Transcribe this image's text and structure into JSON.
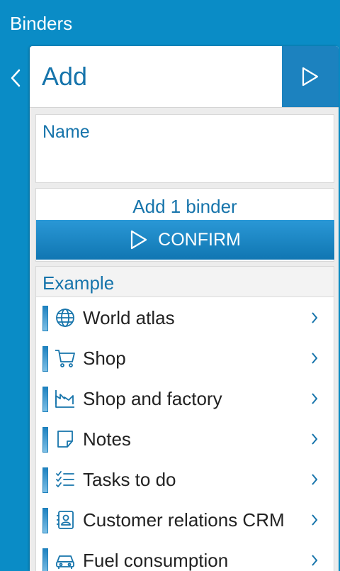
{
  "topbar": {
    "title": "Binders"
  },
  "panel": {
    "title": "Add"
  },
  "form": {
    "name_label": "Name"
  },
  "summary": {
    "count_text": "Add 1 binder",
    "confirm_label": "CONFIRM"
  },
  "list": {
    "header": "Example",
    "items": [
      {
        "label": "World atlas",
        "icon": "globe-icon"
      },
      {
        "label": "Shop",
        "icon": "cart-icon"
      },
      {
        "label": "Shop and factory",
        "icon": "factory-icon"
      },
      {
        "label": "Notes",
        "icon": "note-icon"
      },
      {
        "label": "Tasks to do",
        "icon": "checklist-icon"
      },
      {
        "label": "Customer relations CRM",
        "icon": "contact-card-icon"
      },
      {
        "label": "Fuel consumption",
        "icon": "car-icon"
      }
    ]
  },
  "colors": {
    "background": "#0a8cc6",
    "accent": "#1674ab",
    "button": "#1c82bf"
  }
}
